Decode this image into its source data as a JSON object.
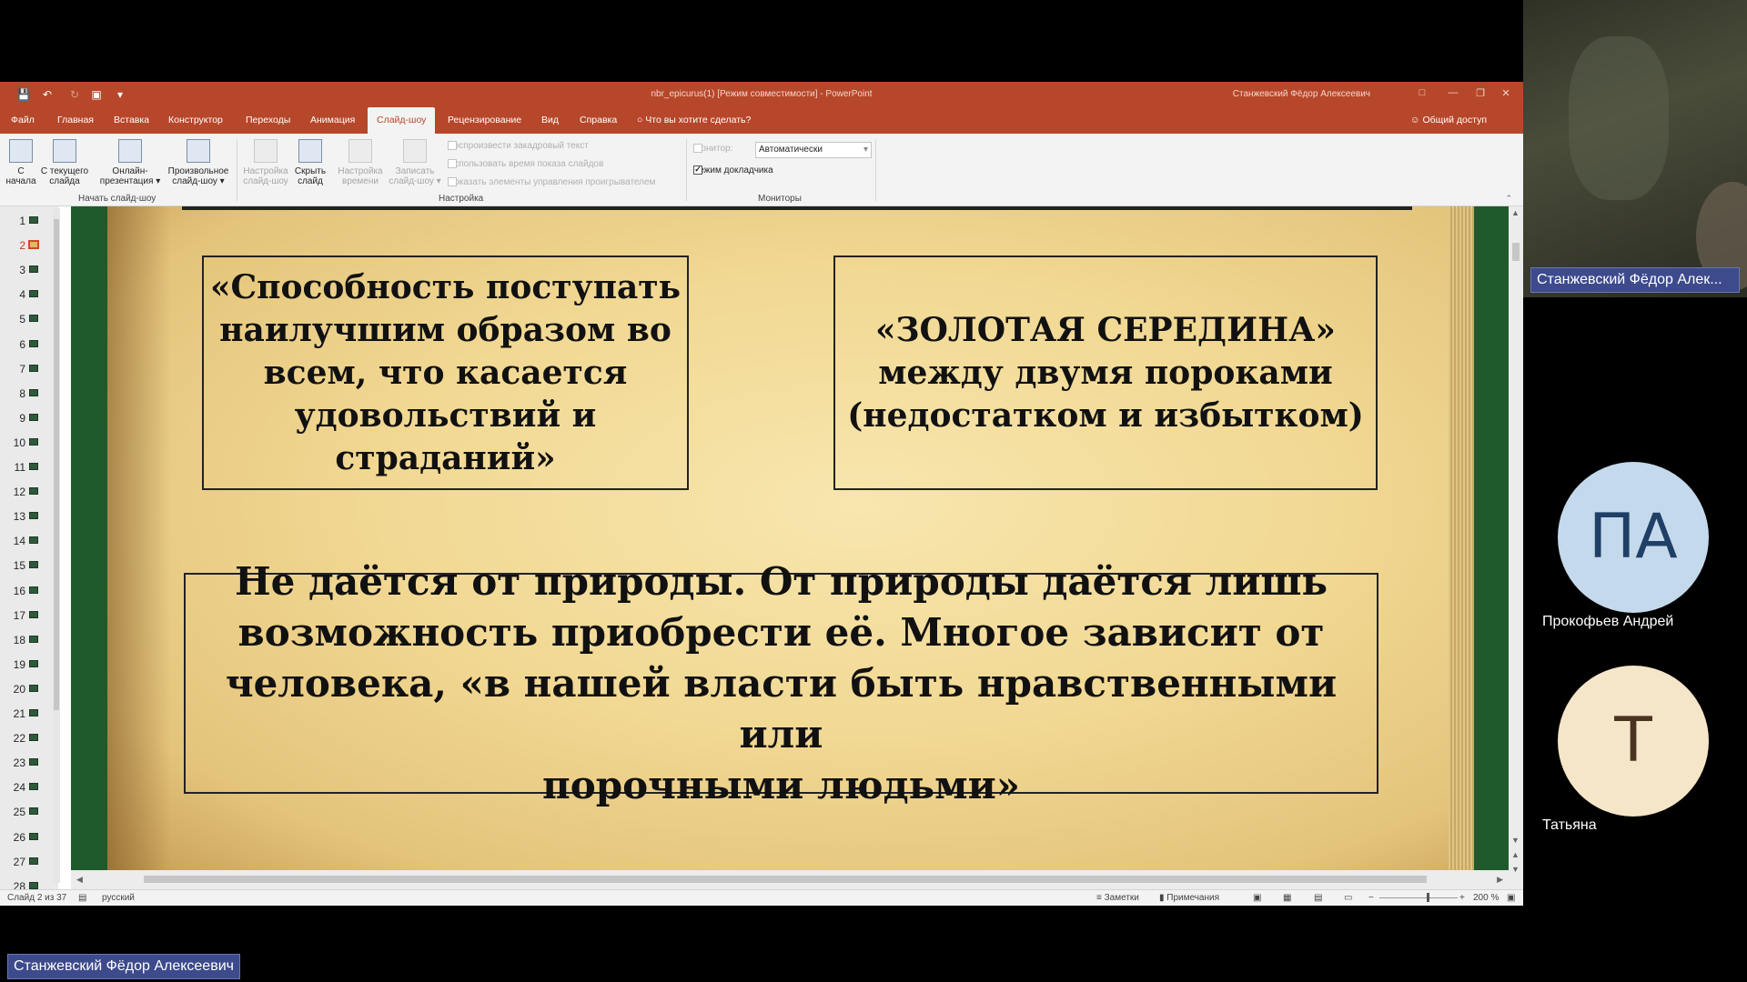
{
  "window": {
    "title": "nbr_epicurus(1) [Режим совместимости]  -  PowerPoint",
    "user": "Станжевский Фёдор Алексеевич"
  },
  "menu": {
    "tabs": [
      "Файл",
      "Главная",
      "Вставка",
      "Конструктор",
      "Переходы",
      "Анимация",
      "Слайд-шоу",
      "Рецензирование",
      "Вид",
      "Справка"
    ],
    "active_tab": "Слайд-шоу",
    "tell_me": "Что вы хотите сделать?",
    "share": "Общий доступ"
  },
  "ribbon": {
    "from_start": [
      "С",
      "начала"
    ],
    "from_current": [
      "С текущего",
      "слайда"
    ],
    "online": [
      "Онлайн-",
      "презентация ▾"
    ],
    "custom": [
      "Произвольное",
      "слайд-шоу ▾"
    ],
    "group_start": "Начать слайд-шоу",
    "setup": [
      "Настройка",
      "слайд-шоу"
    ],
    "hide": [
      "Скрыть",
      "слайд"
    ],
    "rehearse": [
      "Настройка",
      "времени"
    ],
    "record": [
      "Записать",
      "слайд-шоу ▾"
    ],
    "play_narrations": "Воспроизвести закадровый текст",
    "use_timings": "Использовать время показа слайдов",
    "show_controls": "Показать элементы управления проигрывателем",
    "group_setup": "Настройка",
    "monitor_label": "Монитор:",
    "monitor_value": "Автоматически",
    "presenter_view": "Режим докладчика",
    "group_monitors": "Мониторы"
  },
  "thumbnails": {
    "numbers": [
      "1",
      "2",
      "3",
      "4",
      "5",
      "6",
      "7",
      "8",
      "9",
      "10",
      "11",
      "12",
      "13",
      "14",
      "15",
      "16",
      "17",
      "18",
      "19",
      "20",
      "21",
      "22",
      "23",
      "24",
      "25",
      "26",
      "27",
      "28"
    ],
    "current": 2
  },
  "slide": {
    "box1": [
      "«Способность поступать",
      "наилучшим образом во",
      "всем, что касается",
      "удовольствий и",
      "страданий»"
    ],
    "box2": [
      "«ЗОЛОТАЯ СЕРЕДИНА»",
      "между двумя пороками",
      "(недостатком и избытком)"
    ],
    "box3": [
      "Не даётся от природы. От природы даётся лишь",
      "возможность приобрести её. Многое зависит от",
      "человека, «в нашей власти быть нравственными или",
      "порочными людьми»"
    ]
  },
  "status": {
    "slide_counter": "Слайд 2 из 37",
    "language": "русский",
    "notes": "Заметки",
    "comments": "Примечания",
    "zoom": "200 %"
  },
  "call": {
    "presenter_tile_name": "Станжевский Фёдор Алек...",
    "participants": [
      {
        "initials": "ПА",
        "name": "Прокофьев Андрей",
        "color": "#c5d9ec",
        "text_color": "#1f3f66"
      },
      {
        "initials": "Т",
        "name": "Татьяна",
        "color": "#f5e6c9",
        "text_color": "#4a3320"
      }
    ],
    "screen_sharer": "Станжевский Фёдор Алексеевич"
  }
}
